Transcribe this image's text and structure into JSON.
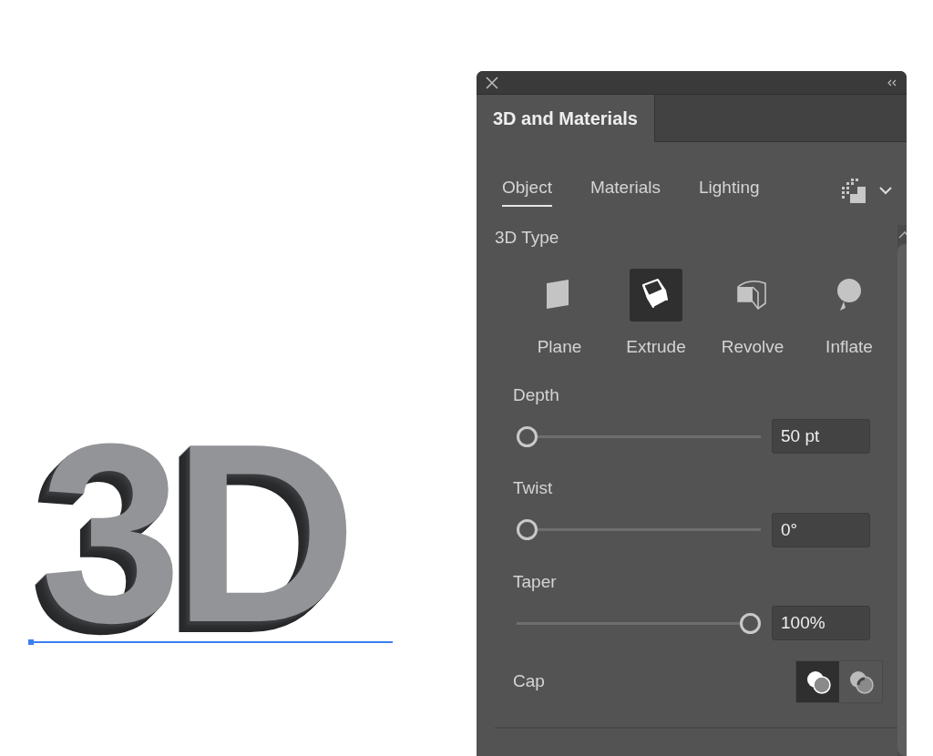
{
  "canvas": {
    "artwork_text": "3D"
  },
  "panel": {
    "title": "3D and Materials",
    "tabs": [
      {
        "label": "Object",
        "selected": true
      },
      {
        "label": "Materials",
        "selected": false
      },
      {
        "label": "Lighting",
        "selected": false
      }
    ],
    "section_title": "3D Type",
    "types": [
      {
        "label": "Plane",
        "kind": "plane",
        "selected": false
      },
      {
        "label": "Extrude",
        "kind": "extrude",
        "selected": true
      },
      {
        "label": "Revolve",
        "kind": "revolve",
        "selected": false
      },
      {
        "label": "Inflate",
        "kind": "inflate",
        "selected": false
      }
    ],
    "sliders": [
      {
        "label": "Depth",
        "level": 0,
        "value": "50 pt"
      },
      {
        "label": "Twist",
        "level": 0,
        "value": "0°"
      },
      {
        "label": "Taper",
        "level": 1,
        "value": "100%"
      }
    ],
    "cap": {
      "label": "Cap",
      "options": [
        {
          "kind": "on",
          "selected": true
        },
        {
          "kind": "off",
          "selected": false
        }
      ]
    }
  }
}
